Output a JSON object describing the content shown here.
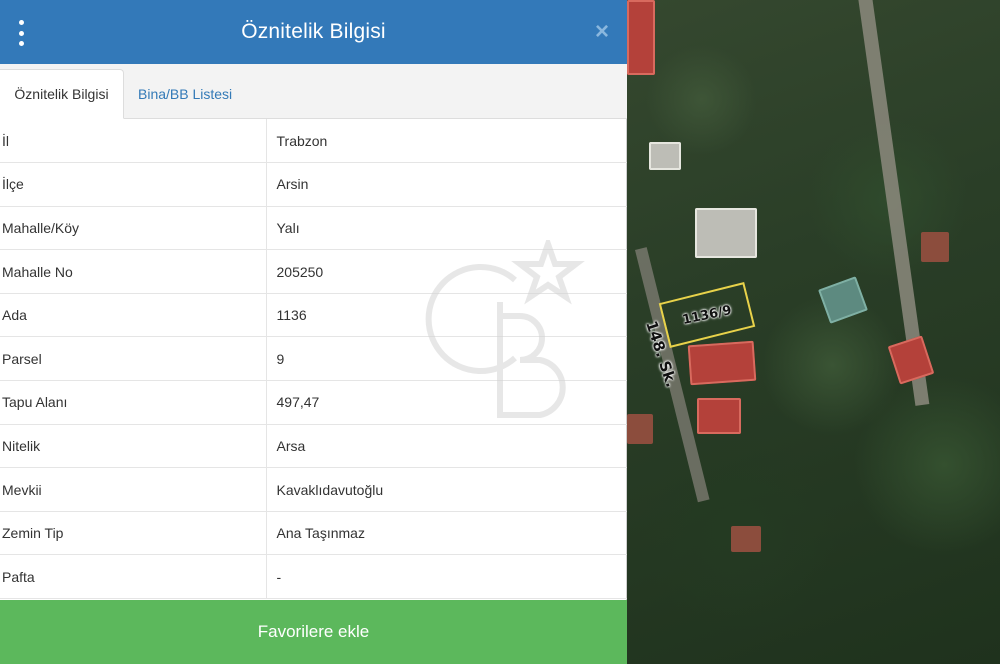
{
  "header": {
    "title": "Öznitelik Bilgisi",
    "close_symbol": "×"
  },
  "tabs": [
    {
      "label": "Öznitelik Bilgisi",
      "active": true
    },
    {
      "label": "Bina/BB Listesi",
      "active": false
    }
  ],
  "attributes": [
    {
      "key": "İl",
      "value": "Trabzon"
    },
    {
      "key": "İlçe",
      "value": "Arsin"
    },
    {
      "key": "Mahalle/Köy",
      "value": "Yalı"
    },
    {
      "key": "Mahalle No",
      "value": "205250"
    },
    {
      "key": "Ada",
      "value": "1136"
    },
    {
      "key": "Parsel",
      "value": "9"
    },
    {
      "key": "Tapu Alanı",
      "value": "497,47"
    },
    {
      "key": "Nitelik",
      "value": "Arsa"
    },
    {
      "key": "Mevkii",
      "value": "Kavaklıdavutoğlu"
    },
    {
      "key": "Zemin Tip",
      "value": "Ana Taşınmaz"
    },
    {
      "key": "Pafta",
      "value": "-"
    }
  ],
  "footer": {
    "button_label": "Favorilere ekle"
  },
  "map": {
    "parcel_label": "1136/9",
    "street_label": "148. Sk."
  },
  "colors": {
    "header": "#3379b9",
    "button": "#5cb85c",
    "parcel_outline": "#e8d24a"
  },
  "icons": {
    "menu": "kebab-menu-icon",
    "close": "close-icon"
  }
}
